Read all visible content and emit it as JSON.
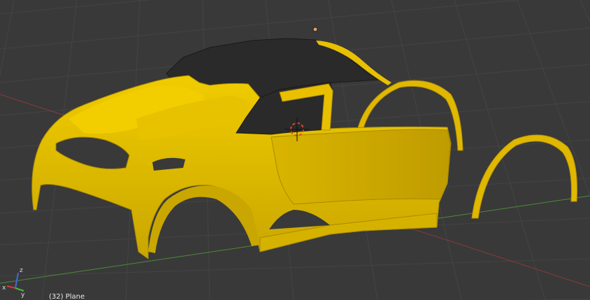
{
  "viewport": {
    "object_info": "(32) Plane",
    "axis_labels": {
      "x": "x",
      "y": "y",
      "z": "z"
    },
    "background_color": "#393939",
    "grid_color": "#444444",
    "x_axis_color": "#8a3a3a",
    "y_axis_color": "#4d8a3a",
    "z_axis_color": "#3a6dd6",
    "mesh_color": "#e8c000",
    "roof_color": "#2a2a2a",
    "cursor_color": "#d84a2a",
    "light_color": "#d9a070"
  }
}
